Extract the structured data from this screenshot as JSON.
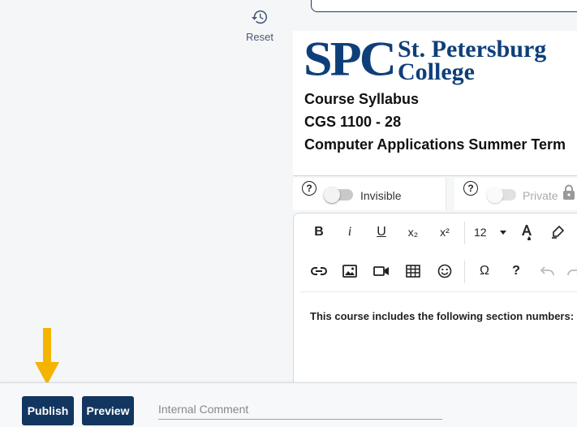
{
  "toolbar_top": {
    "reset_label": "Reset"
  },
  "header": {
    "logo_text": {
      "abbr": "SPC",
      "line1": "St. Petersburg",
      "line2": "College"
    },
    "course_title": "Course Syllabus",
    "course_code": "CGS 1100 - 28",
    "course_name": "Computer Applications Summer Term"
  },
  "toggles": {
    "visibility": {
      "help": "?",
      "label": "Invisible"
    },
    "privacy": {
      "help": "?",
      "label": "Private"
    }
  },
  "editor": {
    "toolbar": {
      "bold": "B",
      "italic": "i",
      "underline": "U",
      "subscript": "x₂",
      "superscript": "x²",
      "font_size": "12",
      "special_chars": "Ω",
      "help": "?"
    },
    "content": "This course includes the following section numbers:"
  },
  "bottom_bar": {
    "publish_label": "Publish",
    "preview_label": "Preview",
    "comment_placeholder": "Internal Comment"
  },
  "colors": {
    "brand_navy": "#12365f",
    "logo_blue": "#0e3f7a",
    "arrow_yellow": "#f4b400"
  }
}
